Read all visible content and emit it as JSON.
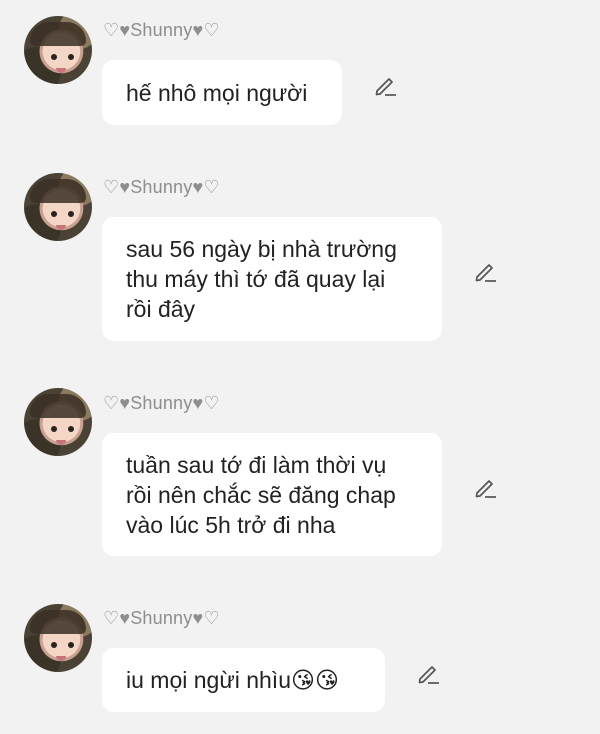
{
  "messages": [
    {
      "author": "♡♥Shunny♥♡",
      "text": "hế nhô mọi người",
      "edit_icon": "pencil-icon"
    },
    {
      "author": "♡♥Shunny♥♡",
      "text": "sau 56 ngày bị nhà trường\nthu máy thì tớ đã quay lại\nrồi đây",
      "edit_icon": "pencil-icon"
    },
    {
      "author": "♡♥Shunny♥♡",
      "text": "tuần sau tớ đi làm thời vụ\nrồi nên chắc sẽ đăng chap\nvào lúc 5h trở đi nha",
      "edit_icon": "pencil-icon"
    },
    {
      "author": "♡♥Shunny♥♡",
      "text": "iu mọi ngừi nhìu😘😘",
      "edit_icon": "pencil-icon"
    }
  ],
  "colors": {
    "background": "#f2f2f2",
    "bubble": "#ffffff",
    "author": "#8e8e8e",
    "text": "#222222"
  }
}
